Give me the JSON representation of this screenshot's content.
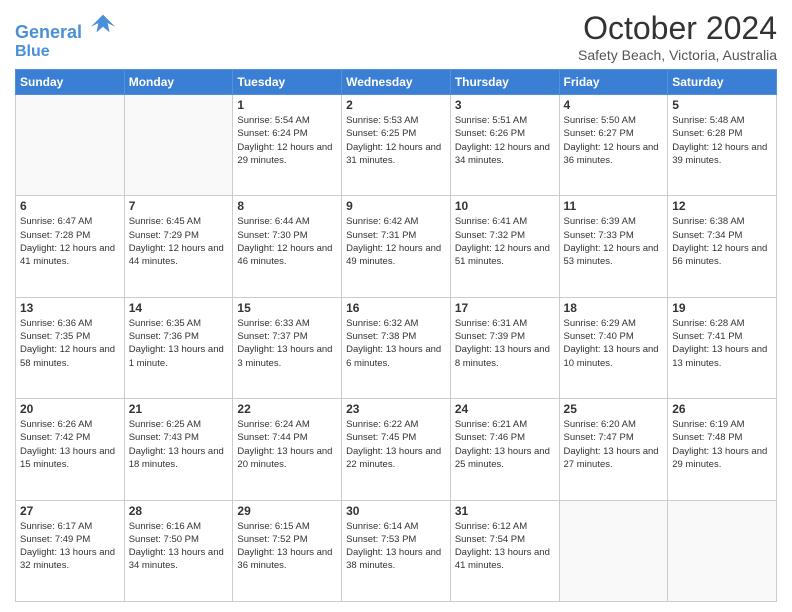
{
  "header": {
    "logo_line1": "General",
    "logo_line2": "Blue",
    "month": "October 2024",
    "location": "Safety Beach, Victoria, Australia"
  },
  "days_of_week": [
    "Sunday",
    "Monday",
    "Tuesday",
    "Wednesday",
    "Thursday",
    "Friday",
    "Saturday"
  ],
  "weeks": [
    [
      {
        "day": "",
        "detail": ""
      },
      {
        "day": "",
        "detail": ""
      },
      {
        "day": "1",
        "detail": "Sunrise: 5:54 AM\nSunset: 6:24 PM\nDaylight: 12 hours and 29 minutes."
      },
      {
        "day": "2",
        "detail": "Sunrise: 5:53 AM\nSunset: 6:25 PM\nDaylight: 12 hours and 31 minutes."
      },
      {
        "day": "3",
        "detail": "Sunrise: 5:51 AM\nSunset: 6:26 PM\nDaylight: 12 hours and 34 minutes."
      },
      {
        "day": "4",
        "detail": "Sunrise: 5:50 AM\nSunset: 6:27 PM\nDaylight: 12 hours and 36 minutes."
      },
      {
        "day": "5",
        "detail": "Sunrise: 5:48 AM\nSunset: 6:28 PM\nDaylight: 12 hours and 39 minutes."
      }
    ],
    [
      {
        "day": "6",
        "detail": "Sunrise: 6:47 AM\nSunset: 7:28 PM\nDaylight: 12 hours and 41 minutes."
      },
      {
        "day": "7",
        "detail": "Sunrise: 6:45 AM\nSunset: 7:29 PM\nDaylight: 12 hours and 44 minutes."
      },
      {
        "day": "8",
        "detail": "Sunrise: 6:44 AM\nSunset: 7:30 PM\nDaylight: 12 hours and 46 minutes."
      },
      {
        "day": "9",
        "detail": "Sunrise: 6:42 AM\nSunset: 7:31 PM\nDaylight: 12 hours and 49 minutes."
      },
      {
        "day": "10",
        "detail": "Sunrise: 6:41 AM\nSunset: 7:32 PM\nDaylight: 12 hours and 51 minutes."
      },
      {
        "day": "11",
        "detail": "Sunrise: 6:39 AM\nSunset: 7:33 PM\nDaylight: 12 hours and 53 minutes."
      },
      {
        "day": "12",
        "detail": "Sunrise: 6:38 AM\nSunset: 7:34 PM\nDaylight: 12 hours and 56 minutes."
      }
    ],
    [
      {
        "day": "13",
        "detail": "Sunrise: 6:36 AM\nSunset: 7:35 PM\nDaylight: 12 hours and 58 minutes."
      },
      {
        "day": "14",
        "detail": "Sunrise: 6:35 AM\nSunset: 7:36 PM\nDaylight: 13 hours and 1 minute."
      },
      {
        "day": "15",
        "detail": "Sunrise: 6:33 AM\nSunset: 7:37 PM\nDaylight: 13 hours and 3 minutes."
      },
      {
        "day": "16",
        "detail": "Sunrise: 6:32 AM\nSunset: 7:38 PM\nDaylight: 13 hours and 6 minutes."
      },
      {
        "day": "17",
        "detail": "Sunrise: 6:31 AM\nSunset: 7:39 PM\nDaylight: 13 hours and 8 minutes."
      },
      {
        "day": "18",
        "detail": "Sunrise: 6:29 AM\nSunset: 7:40 PM\nDaylight: 13 hours and 10 minutes."
      },
      {
        "day": "19",
        "detail": "Sunrise: 6:28 AM\nSunset: 7:41 PM\nDaylight: 13 hours and 13 minutes."
      }
    ],
    [
      {
        "day": "20",
        "detail": "Sunrise: 6:26 AM\nSunset: 7:42 PM\nDaylight: 13 hours and 15 minutes."
      },
      {
        "day": "21",
        "detail": "Sunrise: 6:25 AM\nSunset: 7:43 PM\nDaylight: 13 hours and 18 minutes."
      },
      {
        "day": "22",
        "detail": "Sunrise: 6:24 AM\nSunset: 7:44 PM\nDaylight: 13 hours and 20 minutes."
      },
      {
        "day": "23",
        "detail": "Sunrise: 6:22 AM\nSunset: 7:45 PM\nDaylight: 13 hours and 22 minutes."
      },
      {
        "day": "24",
        "detail": "Sunrise: 6:21 AM\nSunset: 7:46 PM\nDaylight: 13 hours and 25 minutes."
      },
      {
        "day": "25",
        "detail": "Sunrise: 6:20 AM\nSunset: 7:47 PM\nDaylight: 13 hours and 27 minutes."
      },
      {
        "day": "26",
        "detail": "Sunrise: 6:19 AM\nSunset: 7:48 PM\nDaylight: 13 hours and 29 minutes."
      }
    ],
    [
      {
        "day": "27",
        "detail": "Sunrise: 6:17 AM\nSunset: 7:49 PM\nDaylight: 13 hours and 32 minutes."
      },
      {
        "day": "28",
        "detail": "Sunrise: 6:16 AM\nSunset: 7:50 PM\nDaylight: 13 hours and 34 minutes."
      },
      {
        "day": "29",
        "detail": "Sunrise: 6:15 AM\nSunset: 7:52 PM\nDaylight: 13 hours and 36 minutes."
      },
      {
        "day": "30",
        "detail": "Sunrise: 6:14 AM\nSunset: 7:53 PM\nDaylight: 13 hours and 38 minutes."
      },
      {
        "day": "31",
        "detail": "Sunrise: 6:12 AM\nSunset: 7:54 PM\nDaylight: 13 hours and 41 minutes."
      },
      {
        "day": "",
        "detail": ""
      },
      {
        "day": "",
        "detail": ""
      }
    ]
  ]
}
